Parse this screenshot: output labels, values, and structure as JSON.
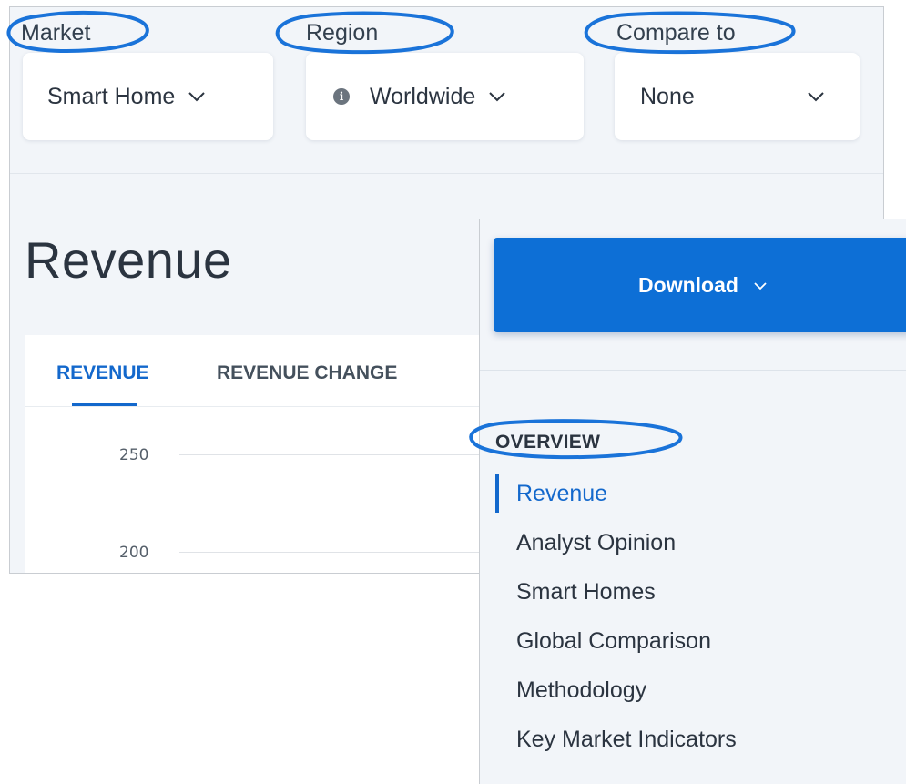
{
  "filters": {
    "market": {
      "label": "Market",
      "value": "Smart Home"
    },
    "region": {
      "label": "Region",
      "value": "Worldwide"
    },
    "compare": {
      "label": "Compare to",
      "value": "None"
    }
  },
  "main": {
    "heading": "Revenue",
    "tabs": [
      {
        "label": "REVENUE",
        "active": true
      },
      {
        "label": "REVENUE CHANGE",
        "active": false
      }
    ],
    "y_ticks": [
      "250",
      "200"
    ]
  },
  "side": {
    "download_label": "Download",
    "section_title": "OVERVIEW",
    "nav_items": [
      {
        "label": "Revenue",
        "active": true
      },
      {
        "label": "Analyst Opinion",
        "active": false
      },
      {
        "label": "Smart Homes",
        "active": false
      },
      {
        "label": "Global Comparison",
        "active": false
      },
      {
        "label": "Methodology",
        "active": false
      },
      {
        "label": "Key Market Indicators",
        "active": false
      }
    ]
  },
  "icons": {
    "dropdown_chevron": "chevron-down-icon",
    "region_info": "info-icon"
  },
  "colors": {
    "accent": "#1368cc",
    "download_button": "#0d6fd6",
    "annotation": "#1a73d9",
    "panel_bg": "#f2f5f9"
  }
}
